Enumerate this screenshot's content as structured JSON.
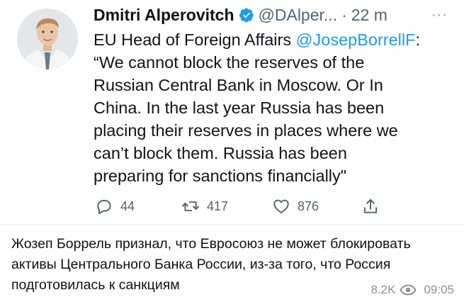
{
  "tweet": {
    "author_name": "Dmitri Alperovitch",
    "handle": "@DAlper...",
    "separator": "·",
    "time": "22 m",
    "more_label": "···",
    "text": {
      "line1_prefix": "EU Head of Foreign Affairs ",
      "line1_mention": "@JosepBorrellF",
      "line1_suffix": ":",
      "line2": "“We cannot block the reserves of the",
      "line3": "Russian Central Bank in Moscow. Or In",
      "line4": "China. In the last year Russia has been",
      "line5": "placing their reserves in places where we",
      "line6": "can’t block them. Russia has been",
      "line7": "preparing for sanctions financially\""
    },
    "actions": {
      "reply_icon": "reply-icon",
      "reply_count": "44",
      "retweet_icon": "retweet-icon",
      "retweet_count": "417",
      "like_icon": "heart-icon",
      "like_count": "876",
      "share_icon": "share-icon"
    },
    "colors": {
      "mention": "#1d9bf0",
      "verified": "#1d9bf0",
      "secondary_text": "#536471"
    }
  },
  "post": {
    "line1": "Жозеп Боррель признал, что Евросоюз не может блокировать",
    "line2": "активы Центрального Банка России, из-за того, что Россия",
    "line3": "подготовилась к санкциям",
    "views": "8.2K",
    "views_icon": "eye-icon",
    "time": "09:05"
  }
}
